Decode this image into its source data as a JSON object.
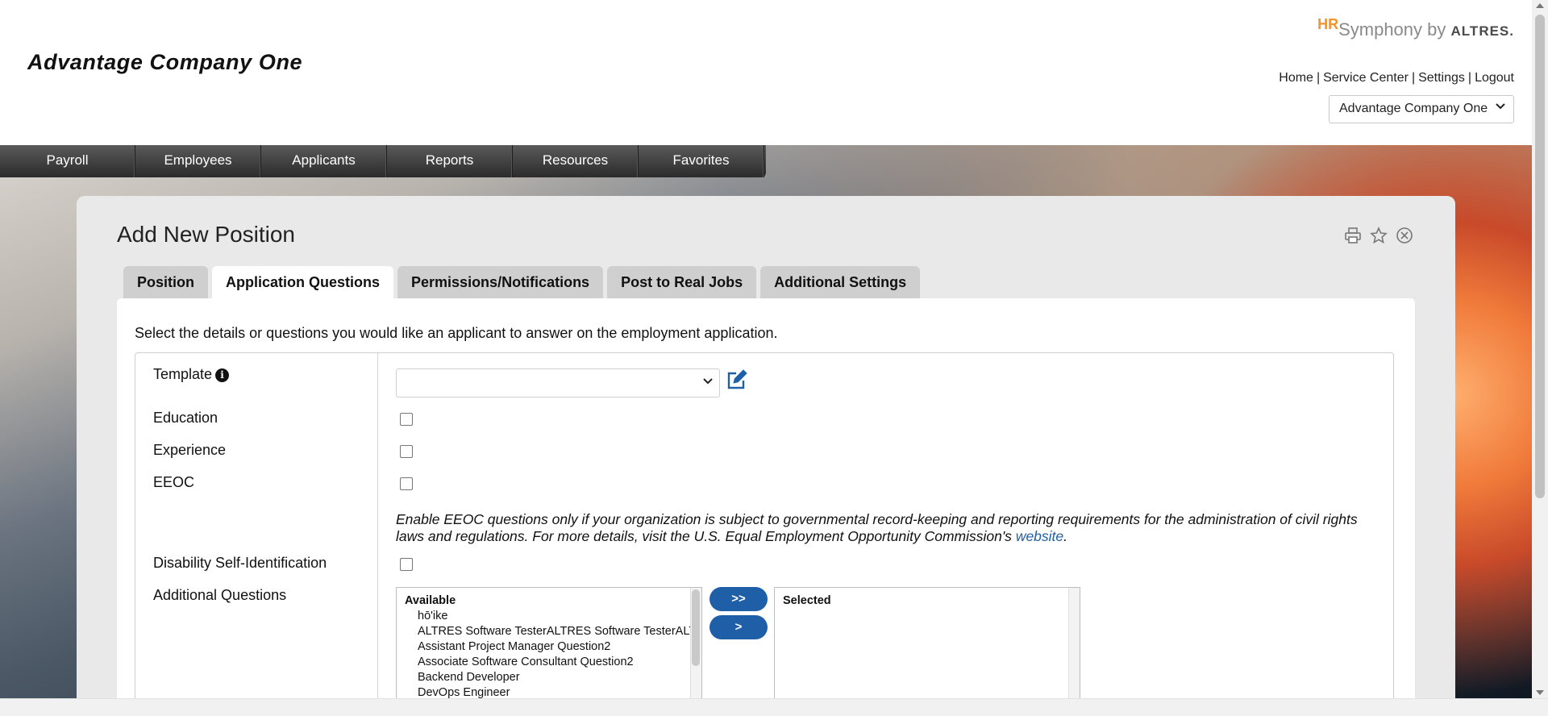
{
  "header": {
    "company_title": "Advantage Company One",
    "brand": {
      "hr": "HR",
      "symphony": "Symphony",
      "by": "by",
      "altres": "ALTRES."
    },
    "links": [
      "Home",
      "Service Center",
      "Settings",
      "Logout"
    ],
    "company_select": "Advantage Company One"
  },
  "nav": {
    "items": [
      "Payroll",
      "Employees",
      "Applicants",
      "Reports",
      "Resources",
      "Favorites"
    ]
  },
  "page": {
    "title": "Add New Position",
    "icons": [
      "print-icon",
      "star-icon",
      "close-icon"
    ],
    "tabs": [
      "Position",
      "Application Questions",
      "Permissions/Notifications",
      "Post to Real Jobs",
      "Additional Settings"
    ],
    "active_tab": "Application Questions",
    "intro": "Select the details or questions you would like an applicant to answer on the employment application.",
    "fields": {
      "template": "Template",
      "template_value": "",
      "education": "Education",
      "experience": "Experience",
      "eeoc": "EEOC",
      "disability": "Disability Self-Identification",
      "additional": "Additional Questions"
    },
    "eeoc_note": {
      "text": "Enable EEOC questions only if your organization is subject to governmental record-keeping and reporting requirements for the administration of civil rights laws and regulations. For more details, visit the U.S. Equal Employment Opportunity Commission's",
      "link": "website",
      "end": "."
    },
    "available": {
      "header": "Available",
      "items": [
        "hō'ike",
        "ALTRES Software TesterALTRES Software TesterALTRES",
        "Assistant Project Manager Question2",
        "Associate Software Consultant Question2",
        "Backend Developer",
        "DevOps Engineer"
      ]
    },
    "buttons": {
      "add_all": ">>",
      "add_one": ">"
    },
    "selected": {
      "header": "Selected",
      "items": []
    }
  }
}
